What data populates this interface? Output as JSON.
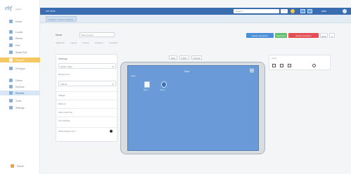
{
  "sidebar": {
    "logo": "ebf",
    "logo_sub": "reiltion",
    "items": [
      {
        "label": "Home",
        "state": "normal"
      },
      {
        "label": "Locals",
        "state": "normal"
      },
      {
        "label": "Rivers",
        "state": "normal"
      },
      {
        "label": "Part",
        "state": "normal"
      },
      {
        "label": "Sheet Pull",
        "state": "normal"
      },
      {
        "label": "Projects",
        "state": "active"
      },
      {
        "label": "Ext Apps",
        "state": "normal"
      },
      {
        "label": "Forms",
        "state": "normal"
      },
      {
        "label": "Devices",
        "state": "normal"
      },
      {
        "label": "Reports",
        "state": "selected"
      },
      {
        "label": "Tools",
        "state": "normal"
      },
      {
        "label": "Settings",
        "state": "normal"
      }
    ],
    "bottom": {
      "label": "Pause"
    }
  },
  "topbar": {
    "title": "ebf Suite",
    "search_placeholder": "Search...",
    "dropdown": "v",
    "user_name": "user"
  },
  "breadcrumb": {
    "label": "Projects / Screen Designer"
  },
  "form": {
    "name_label": "Name",
    "name_value": "Mein Screen",
    "tabs": [
      "Allgemein",
      "Layout",
      "Screen",
      "Designer",
      "Vorschau"
    ]
  },
  "buttons": {
    "publish": "Screen speichern",
    "save": "Speichern",
    "delete": "Screen loeschen",
    "back": "Back",
    "close": "X"
  },
  "left_panel": {
    "title": "Settings",
    "field1": "Screen Type",
    "label1": "Background",
    "field2": "Theme",
    "rows": [
      "Widget",
      "Buttons",
      "Apps Launcher",
      "Icon Shapes",
      "Show Screen Icon"
    ]
  },
  "center_toolbar": {
    "device": "iPad",
    "zoom": "100%",
    "orientation": "Portrait"
  },
  "tablet": {
    "screen_title": "Start",
    "screen_sub": "Apps",
    "apps": [
      {
        "label": "App 1",
        "icon": "document-icon"
      },
      {
        "label": "App 2",
        "icon": "settings-app-icon"
      }
    ]
  },
  "right_panel": {
    "title": "Tools"
  }
}
